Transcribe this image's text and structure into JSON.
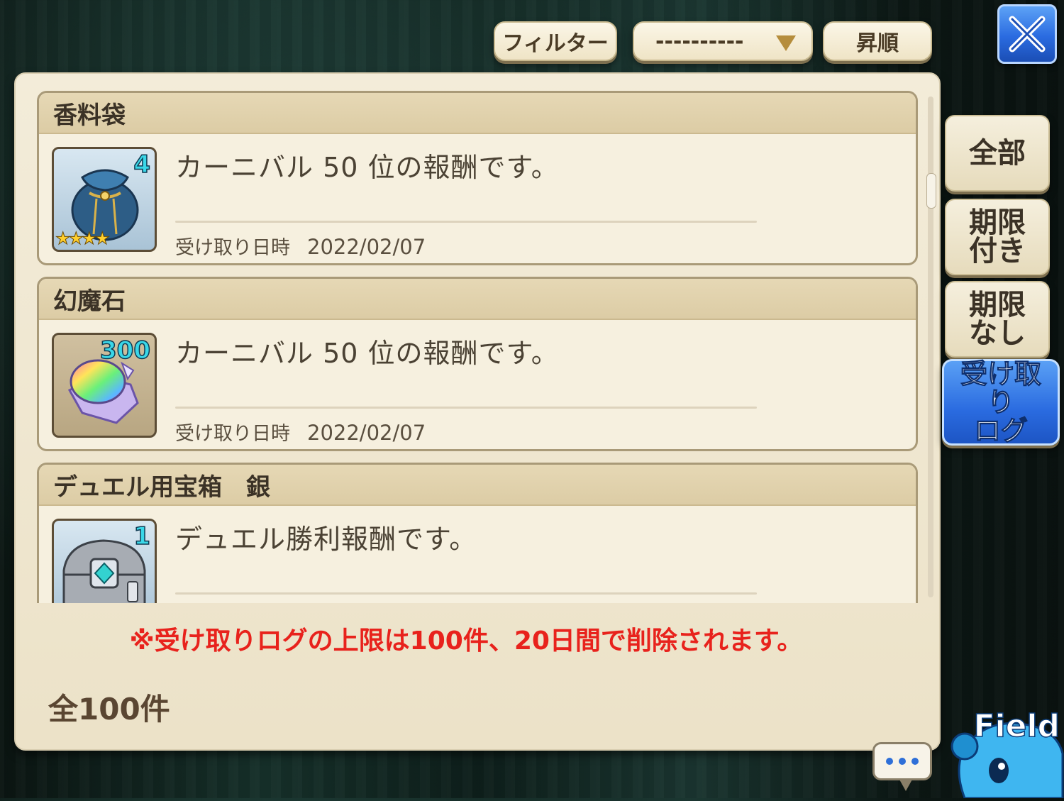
{
  "toolbar": {
    "filter_label": "フィルター",
    "sort_value": "----------",
    "order_label": "昇順"
  },
  "side_tabs": {
    "all": "全部",
    "limited": "期限\n付き",
    "unlimited": "期限\nなし",
    "log": "受け取り\nログ"
  },
  "items": [
    {
      "title": "香料袋",
      "quantity": "4",
      "stars": "★★★★",
      "description": "カーニバル 50 位の報酬です。",
      "received_label": "受け取り日時",
      "received_date": "2022/02/07"
    },
    {
      "title": "幻魔石",
      "quantity": "300",
      "description": "カーニバル 50 位の報酬です。",
      "received_label": "受け取り日時",
      "received_date": "2022/02/07"
    },
    {
      "title": "デュエル用宝箱　銀",
      "quantity": "1",
      "description": "デュエル勝利報酬です。"
    }
  ],
  "notice": "※受け取りログの上限は100件、20日間で削除されます。",
  "total": "全100件",
  "field_label": "Field",
  "colors": {
    "notice": "#e8221c",
    "active_tab": "#2a6be0",
    "panel": "#f3ecd9"
  }
}
